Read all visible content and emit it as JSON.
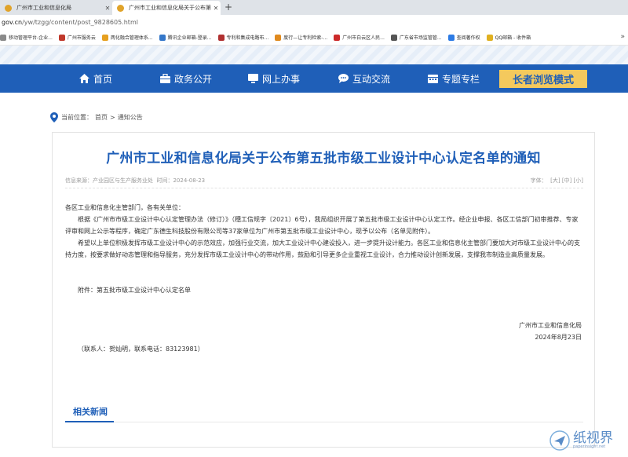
{
  "browser": {
    "tabs": [
      {
        "title": "广州市工业和信息化局"
      },
      {
        "title": "广州市工业和信息化局关于公布第"
      }
    ],
    "address": {
      "domain": "gov.cn",
      "path": "/yw/tzgg/content/post_9828605.html"
    },
    "bookmarks": [
      {
        "label": "移动管理平台-企业...",
        "color": "#8a8a8a"
      },
      {
        "label": "广州市服务云",
        "color": "#c0392b"
      },
      {
        "label": "两化融合管理体系...",
        "color": "#e6a020"
      },
      {
        "label": "腾讯企业邮箱-登录...",
        "color": "#3477c9"
      },
      {
        "label": "专利和集成电路布...",
        "color": "#b03030"
      },
      {
        "label": "度行—让专利检索-...",
        "color": "#e08a1e"
      },
      {
        "label": "广州市白云区人民...",
        "color": "#cc2a2a"
      },
      {
        "label": "广东省市场监管管...",
        "color": "#555555"
      },
      {
        "label": "查阅著作权",
        "color": "#2c7be5"
      },
      {
        "label": "QQ邮箱 - 收件箱",
        "color": "#e0b020"
      }
    ]
  },
  "nav": {
    "items": [
      {
        "label": "首页",
        "icon": "home-icon"
      },
      {
        "label": "政务公开",
        "icon": "briefcase-icon"
      },
      {
        "label": "网上办事",
        "icon": "monitor-icon"
      },
      {
        "label": "互动交流",
        "icon": "chat-icon"
      },
      {
        "label": "专题专栏",
        "icon": "calendar-icon"
      }
    ],
    "elder_mode": "长者浏览模式"
  },
  "breadcrumb": {
    "prefix": "当前位置：",
    "home": "首页",
    "sep": ">",
    "current": "通知公告"
  },
  "article": {
    "title": "广州市工业和信息化局关于公布第五批市级工业设计中心认定名单的通知",
    "source": "信息来源：产业园区与生产服务业处",
    "time": "时间：2024-08-23",
    "font_label": "字体：",
    "font_large": "[大]",
    "font_medium": "[中]",
    "font_small": "[小]",
    "greeting": "各区工业和信息化主管部门，各有关单位：",
    "para1": "根据《广州市市级工业设计中心认定管理办法（修订）》（穗工信规字〔2021〕6号），我局组织开展了第五批市级工业设计中心认定工作。经企业申报、各区工信部门初审推荐、专家评审和网上公示等程序，确定广东德生科技股份有限公司等37家单位为广州市第五批市级工业设计中心，现予以公布（名单见附件）。",
    "para2": "希望以上单位积极发挥市级工业设计中心的示范效应，加强行业交流，加大工业设计中心建设投入，进一步提升设计能力。各区工业和信息化主管部门要加大对市级工业设计中心的支持力度，按要求做好动态管理和指导服务，充分发挥市级工业设计中心的带动作用，鼓励和引导更多企业重视工业设计，合力推动设计创新发展，支撑我市制造业高质量发展。",
    "attachment": "附件：第五批市级工业设计中心认定名单",
    "signature": "广州市工业和信息化局",
    "date": "2024年8月23日",
    "contact": "（联系人：贺灿明，联系电话：83123981）"
  },
  "related": {
    "label": "相关新闻"
  },
  "watermark": {
    "cn": "纸视界",
    "en": "paperinsight.net"
  }
}
